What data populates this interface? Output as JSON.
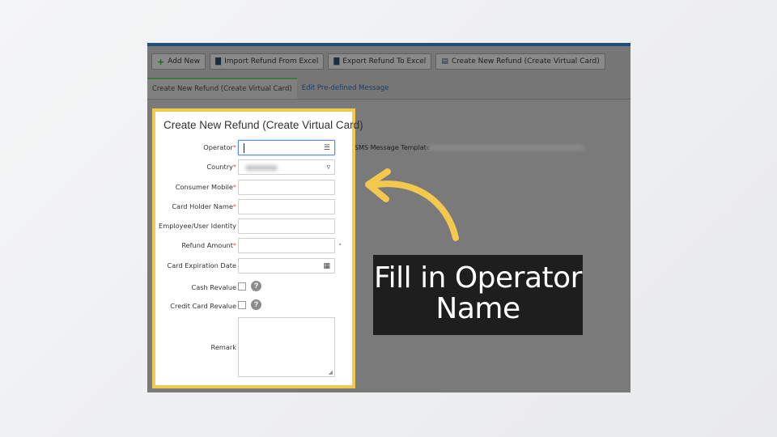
{
  "toolbar": {
    "add_new": "Add New",
    "import_refund": "Import Refund From Excel",
    "export_refund": "Export Refund To Excel",
    "create_new_refund": "Create New Refund (Create Virtual Card)"
  },
  "tabs": {
    "active": "Create New Refund (Create Virtual Card)",
    "edit_message": "Edit Pre-defined Message"
  },
  "sms": {
    "label": "SMS Message Template"
  },
  "form": {
    "title": "Create New Refund (Create Virtual Card)",
    "operator_label": "Operator",
    "country_label": "Country",
    "consumer_mobile_label": "Consumer Mobile",
    "card_holder_label": "Card Holder Name",
    "employee_label": "Employee/User Identity",
    "refund_amount_label": "Refund Amount",
    "card_exp_label": "Card Expiration Date",
    "cash_revalue_label": "Cash Revalue",
    "credit_revalue_label": "Credit Card Revalue",
    "remark_label": "Remark",
    "required_mark": "*",
    "help_glyph": "?"
  },
  "callout": {
    "line1": "Fill in Operator",
    "line2": "Name"
  },
  "colors": {
    "highlight": "#f2c94c",
    "arrow": "#f2c94c",
    "callout_bg": "#1e1e1e"
  },
  "icons": {
    "plus": "plus-icon",
    "excel": "excel-icon",
    "list": "list-icon",
    "dropdown": "chevron-down-icon",
    "calendar": "calendar-icon",
    "help": "help-icon"
  }
}
